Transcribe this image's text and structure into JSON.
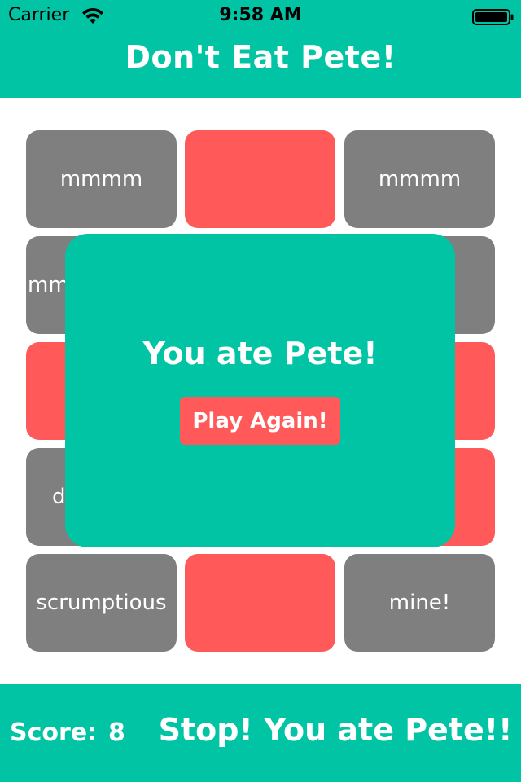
{
  "status_bar": {
    "carrier": "Carrier",
    "time": "9:58 AM"
  },
  "header": {
    "title": "Don't Eat Pete!"
  },
  "tiles": [
    {
      "label": "mmmm",
      "color": "gray"
    },
    {
      "label": "",
      "color": "red"
    },
    {
      "label": "mmmm",
      "color": "gray"
    },
    {
      "label": "mm",
      "color": "gray"
    },
    {
      "label": "",
      "color": "gray"
    },
    {
      "label": "",
      "color": "gray"
    },
    {
      "label": "",
      "color": "red"
    },
    {
      "label": "",
      "color": "gray"
    },
    {
      "label": "",
      "color": "red"
    },
    {
      "label": "d",
      "color": "gray"
    },
    {
      "label": "",
      "color": "gray"
    },
    {
      "label": "",
      "color": "red"
    },
    {
      "label": "scrumptious",
      "color": "gray"
    },
    {
      "label": "",
      "color": "red"
    },
    {
      "label": "mine!",
      "color": "gray"
    }
  ],
  "modal": {
    "title": "You ate Pete!",
    "button_label": "Play Again!"
  },
  "footer": {
    "score_label": "Score:",
    "score_value": "8",
    "message": "Stop! You ate Pete!!"
  },
  "colors": {
    "accent": "#00c4a4",
    "tile_gray": "#7f7f7f",
    "tile_red": "#ff5959"
  }
}
